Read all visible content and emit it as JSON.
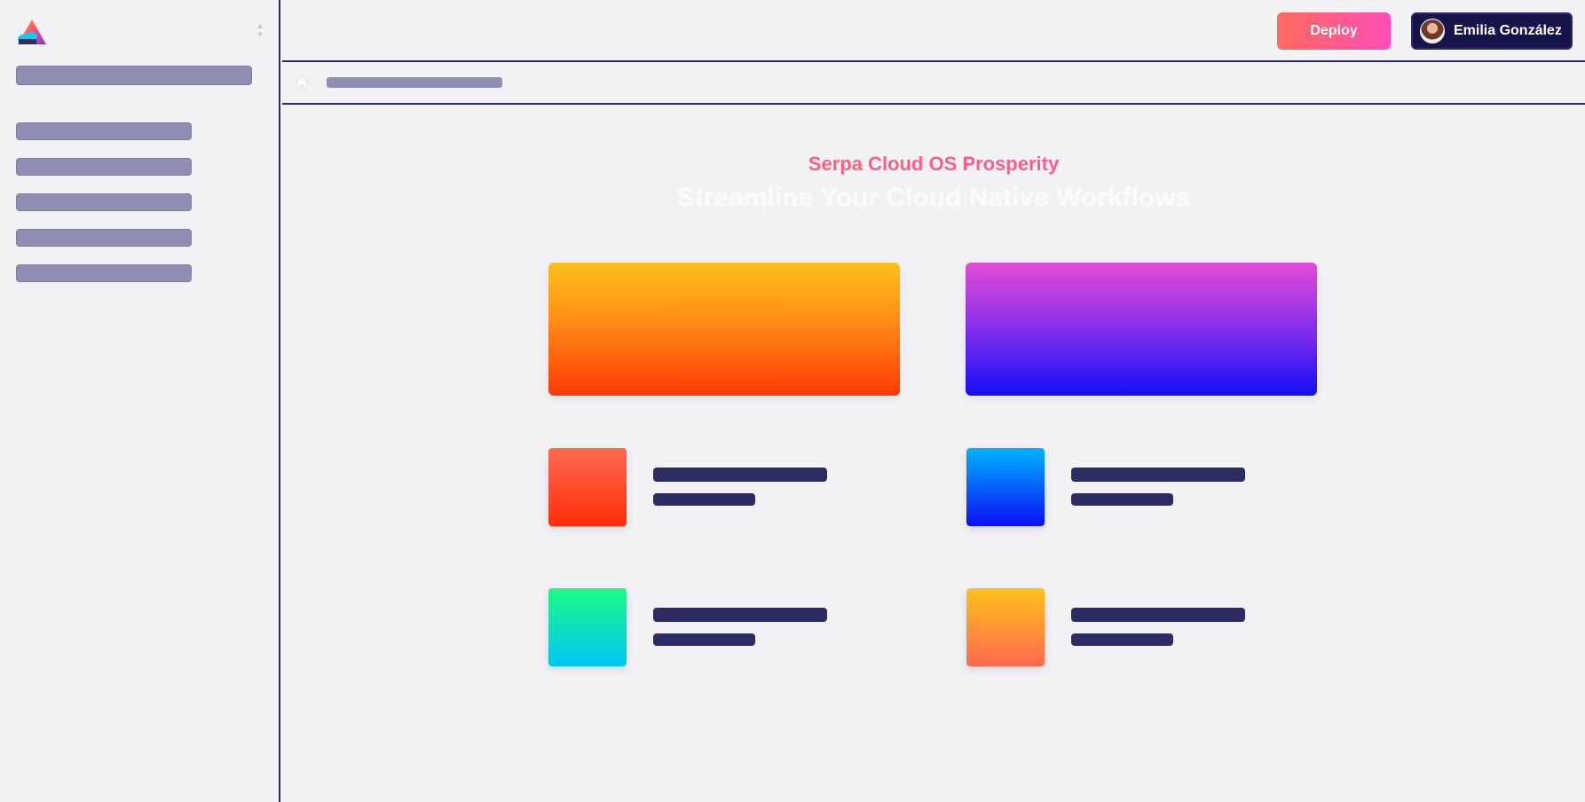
{
  "header": {
    "deploy_label": "Deploy",
    "user_name": "Emilia González"
  },
  "main": {
    "eyebrow": "Serpa Cloud OS Prosperity",
    "headline": "Streamline Your Cloud Native Workflows"
  },
  "colors": {
    "sidebar_border": "#2c2b63",
    "skeleton": "#8e8eb3",
    "accent_start": "#ff6a5b",
    "accent_end": "#ff4fb8",
    "user_button_bg": "#16144a"
  },
  "icons": {
    "home": "home-icon",
    "logo": "cloud-logo-icon",
    "switcher": "chevron-up-down-icon",
    "avatar": "user-avatar"
  }
}
